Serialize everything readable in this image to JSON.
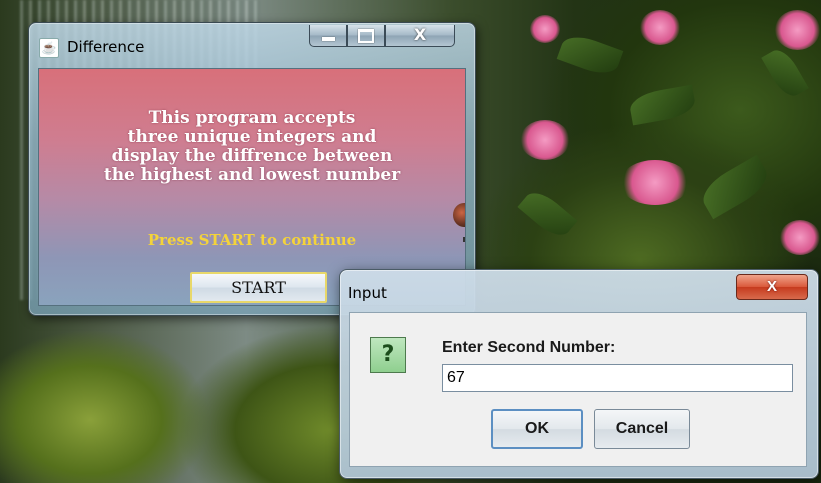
{
  "frame": {
    "title": "Difference",
    "intro_lines": [
      "This program accepts",
      "three unique integers and",
      "display the diffrence between",
      "the highest and lowest number"
    ],
    "prompt": "Press START to continue",
    "start_label": "START",
    "close_glyph": "X"
  },
  "dialog": {
    "title": "Input",
    "close_glyph": "X",
    "icon_glyph": "?",
    "label": "Enter Second Number:",
    "input_value": "67",
    "ok_label": "OK",
    "cancel_label": "Cancel"
  },
  "icons": {
    "frame": "java-cup-icon",
    "question": "question-icon"
  },
  "colors": {
    "prompt_text": "#f4d33a",
    "close_button": "#c63b1e",
    "start_border": "#e8d86a"
  }
}
